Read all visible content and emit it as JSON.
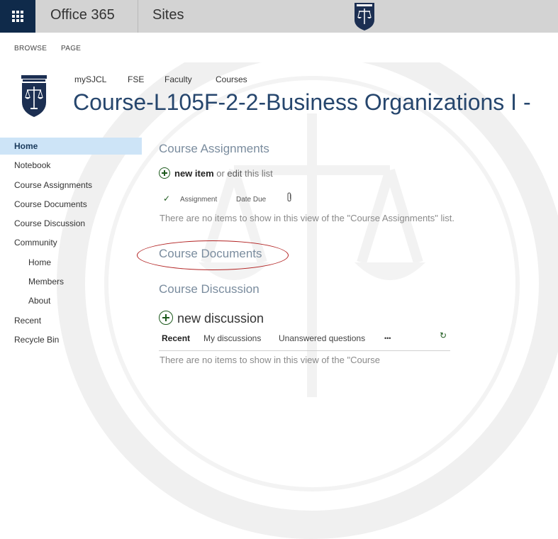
{
  "suite_bar": {
    "brand": "Office 365",
    "app": "Sites"
  },
  "ribbon": {
    "tabs": [
      "BROWSE",
      "PAGE"
    ]
  },
  "header": {
    "top_nav": [
      "mySJCL",
      "FSE",
      "Faculty",
      "Courses"
    ],
    "title": "Course-L105F-2-2-Business Organizations I -"
  },
  "left_nav": {
    "items": [
      "Home",
      "Notebook",
      "Course Assignments",
      "Course Documents",
      "Course Discussion",
      "Community"
    ],
    "community_sub": [
      "Home",
      "Members",
      "About"
    ],
    "bottom": [
      "Recent",
      "Recycle Bin"
    ]
  },
  "assignments": {
    "title": "Course Assignments",
    "new_item": "new item",
    "or": " or ",
    "edit": "edit",
    "this_list": " this list",
    "columns": [
      "Assignment",
      "Date Due"
    ],
    "empty": "There are no items to show in this view of the \"Course Assignments\" list."
  },
  "documents": {
    "title": "Course Documents"
  },
  "discussion": {
    "title": "Course Discussion",
    "new_discussion": "new discussion",
    "tabs": [
      "Recent",
      "My discussions",
      "Unanswered questions",
      "•••"
    ],
    "empty": "There are no items to show in this view of the \"Course"
  },
  "colors": {
    "suite_bar": "#d3d3d3",
    "waffle": "#0f2a4a",
    "title": "#26466d",
    "nav_selected": "#cde4f7",
    "annotation": "#b22222"
  }
}
